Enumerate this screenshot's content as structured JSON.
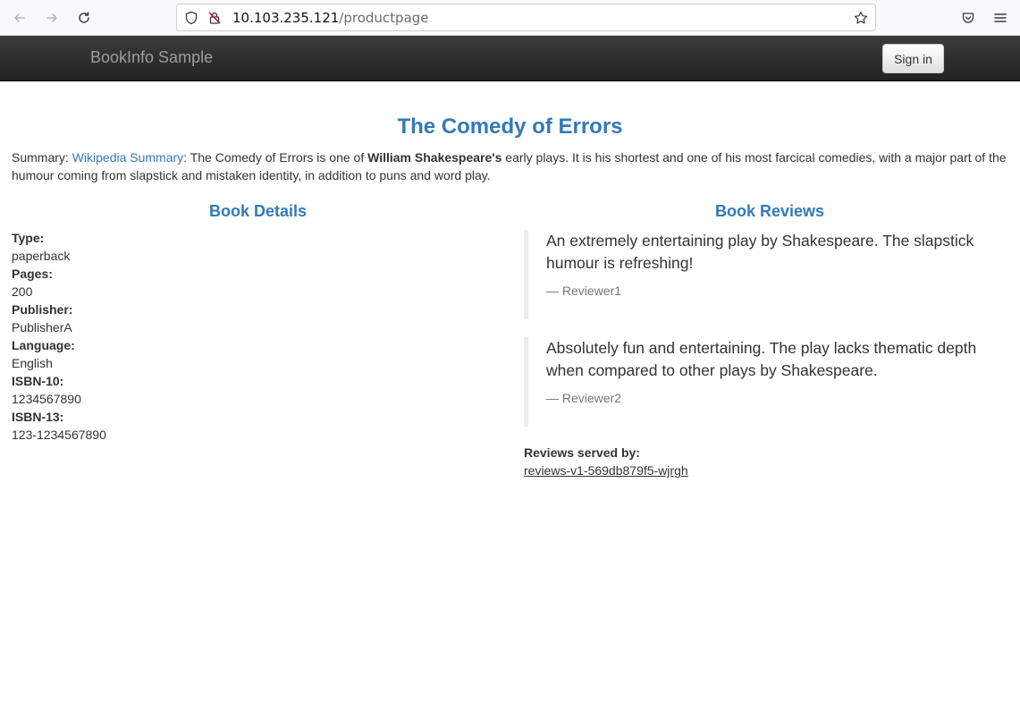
{
  "browser": {
    "url_host": "10.103.235.121",
    "url_path": "/productpage",
    "icons": [
      "back-icon",
      "forward-icon",
      "reload-icon",
      "shield-icon",
      "insecure-lock-icon",
      "bookmark-star-icon",
      "pocket-icon",
      "menu-icon"
    ]
  },
  "navbar": {
    "brand": "BookInfo Sample",
    "signin_label": "Sign in"
  },
  "product": {
    "title": "The Comedy of Errors",
    "summary_prefix": "Summary: ",
    "summary_link": "Wikipedia Summary",
    "summary_text_1": ": The Comedy of Errors is one of ",
    "summary_bold": "William Shakespeare's",
    "summary_text_2": " early plays. It is his shortest and one of his most farcical comedies, with a major part of the humour coming from slapstick and mistaken identity, in addition to puns and word play."
  },
  "details": {
    "heading": "Book Details",
    "rows": [
      {
        "label": "Type:",
        "value": "paperback"
      },
      {
        "label": "Pages:",
        "value": "200"
      },
      {
        "label": "Publisher:",
        "value": "PublisherA"
      },
      {
        "label": "Language:",
        "value": "English"
      },
      {
        "label": "ISBN-10:",
        "value": "1234567890"
      },
      {
        "label": "ISBN-13:",
        "value": "123-1234567890"
      }
    ]
  },
  "reviews": {
    "heading": "Book Reviews",
    "items": [
      {
        "text": "An extremely entertaining play by Shakespeare. The slapstick humour is refreshing!",
        "reviewer": "— Reviewer1"
      },
      {
        "text": "Absolutely fun and entertaining. The play lacks thematic depth when compared to other plays by Shakespeare.",
        "reviewer": "— Reviewer2"
      }
    ],
    "served_by_label": "Reviews served by:",
    "served_by_value": "reviews-v1-569db879f5-wjrgh"
  },
  "colors": {
    "accent": "#337ab7",
    "navbar": "#222222",
    "text": "#333333"
  }
}
